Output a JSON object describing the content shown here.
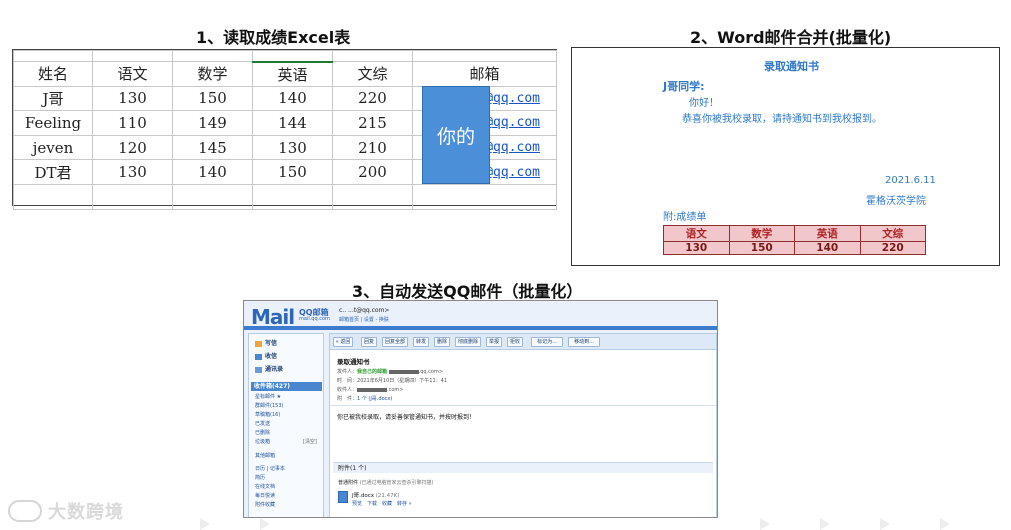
{
  "titles": {
    "step1": "1、读取成绩Excel表",
    "step2": "2、Word邮件合并(批量化)",
    "step3": "3、自动发送QQ邮件（批量化）"
  },
  "excel": {
    "headers": [
      "姓名",
      "语文",
      "数学",
      "英语",
      "文综",
      "邮箱"
    ],
    "rows": [
      [
        "J哥",
        "130",
        "150",
        "140",
        "220",
        "@qq.com"
      ],
      [
        "Feeling",
        "110",
        "149",
        "144",
        "215",
        "@qq.com"
      ],
      [
        "jeven",
        "120",
        "145",
        "130",
        "210",
        "0@qq.com"
      ],
      [
        "DT君",
        "130",
        "140",
        "150",
        "200",
        "2@qq.com"
      ]
    ],
    "overlay_text": "你的"
  },
  "letter": {
    "title": "录取通知书",
    "salutation": "J哥同学:",
    "greeting": "你好！",
    "body": "恭喜你被我校录取，请持通知书到我校报到。",
    "date": "2021.6.11",
    "school": "霍格沃茨学院",
    "attachment_label": "附:成绩单",
    "score_headers": [
      "语文",
      "数学",
      "英语",
      "文综"
    ],
    "score_values": [
      "130",
      "150",
      "140",
      "220"
    ]
  },
  "qqmail": {
    "logo": "Mail",
    "logo_cn": "QQ邮箱",
    "logo_url": "mail.qq.com",
    "account": "c..  ...t@qq.com>",
    "account_links": "邮箱首页 | 设置 - 换肤",
    "sidebar_top": [
      "写信",
      "收信",
      "通讯录"
    ],
    "inbox": "收件箱(427)",
    "sidebar_items": [
      "星标邮件 ★",
      "群邮件(153)",
      "草稿箱(16)",
      "已发送",
      "已删除",
      "垃圾箱",
      "其他邮箱",
      "日历 | 记事本",
      "简历",
      "在线文档",
      "每日悦读",
      "附件收藏"
    ],
    "spam_clear": "[清空]",
    "toolbar": [
      "« 返回",
      "回复",
      "回复全部",
      "转发",
      "删除",
      "彻底删除",
      "举报",
      "拒收",
      "标记为...",
      "移动到..."
    ],
    "subject": "录取通知书",
    "from_label": "发件人：",
    "from_name": "我自己的邮箱",
    "from_addr": ".qq.com>",
    "time_label": "时　间：",
    "time_value": "2021年6月10日（星期四）下午11：41",
    "to_label": "收件人：",
    "to_addr": ".com>",
    "att_label": "附　件：",
    "att_value": "1 个 (J哥.docx)",
    "body": "你已被我校录取，请妥善保管通知书，并按时报到！",
    "attachments_header": "附件(1 个)",
    "normal_att": "普通附件",
    "normal_att_note": "(已通过电脑管家云查杀引擎扫描)",
    "file_name": "J哥.docx",
    "file_size": "(21.47K)",
    "file_actions": "预览　下载　收藏　转存 »"
  },
  "watermark": "大数跨境"
}
